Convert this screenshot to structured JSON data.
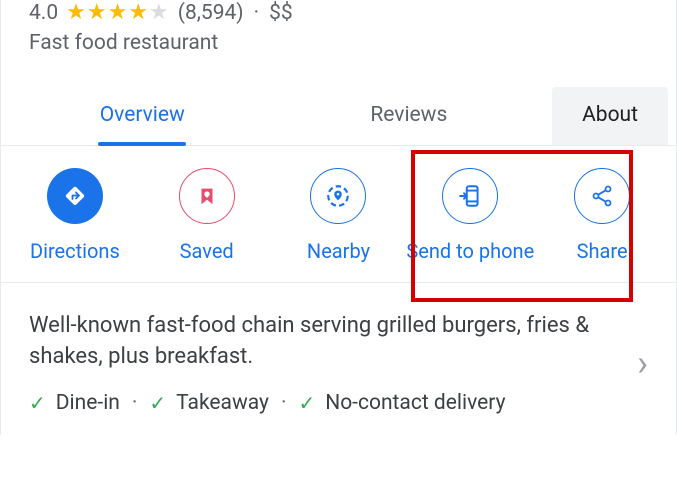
{
  "rating": {
    "value": "4.0",
    "reviews_count": "(8,594)",
    "separator": "·",
    "price": "$$"
  },
  "category": "Fast food restaurant",
  "tabs": {
    "overview": "Overview",
    "reviews": "Reviews",
    "about": "About"
  },
  "actions": {
    "directions": "Directions",
    "saved": "Saved",
    "nearby": "Nearby",
    "send_to_phone": "Send to phone",
    "share": "Share"
  },
  "description": {
    "text": "Well-known fast-food chain serving grilled burgers, fries & shakes, plus breakfast.",
    "options": {
      "dinein": "Dine-in",
      "takeaway": "Takeaway",
      "delivery": "No-contact delivery"
    }
  }
}
